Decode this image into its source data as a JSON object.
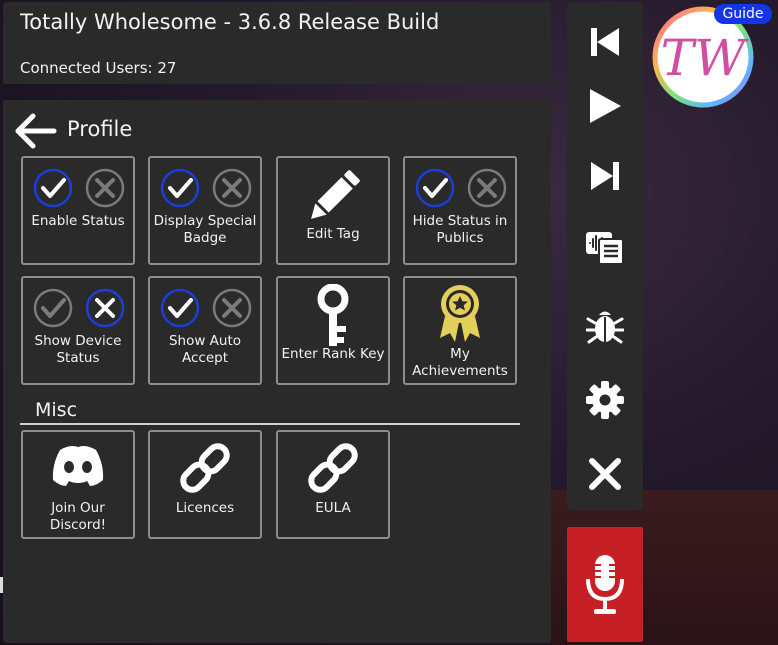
{
  "header": {
    "title": "Totally Wholesome - 3.6.8 Release Build",
    "connected_users": "Connected Users: 27"
  },
  "profile": {
    "title": "Profile",
    "tiles": [
      {
        "label": "Enable Status",
        "icon": "check-icon",
        "state": "enabled"
      },
      {
        "label": "Display Special Badge",
        "icon": "check-icon",
        "state": "enabled"
      },
      {
        "label": "Edit Tag",
        "icon": "pencil-icon"
      },
      {
        "label": "Hide Status in Publics",
        "icon": "check-icon",
        "state": "enabled"
      },
      {
        "label": "Show Device Status",
        "icon": "cross-icon",
        "state": "disabled"
      },
      {
        "label": "Show Auto Accept",
        "icon": "check-icon",
        "state": "enabled"
      },
      {
        "label": "Enter Rank Key",
        "icon": "key-icon"
      },
      {
        "label": "My Achievements",
        "icon": "award-ribbon-icon"
      }
    ]
  },
  "misc": {
    "title": "Misc",
    "tiles": [
      {
        "label": "Join Our Discord!",
        "icon": "discord-icon"
      },
      {
        "label": "Licences",
        "icon": "link-icon"
      },
      {
        "label": "EULA",
        "icon": "link-icon"
      }
    ]
  },
  "sidebar": {
    "items": [
      "skip-previous-icon",
      "play-icon",
      "skip-next-icon",
      "voice-transcript-icon",
      "bug-icon",
      "gear-icon",
      "close-icon"
    ]
  },
  "logo": {
    "text": "TW",
    "guide_label": "Guide"
  },
  "colors": {
    "panel": "#2a2a2a",
    "accent_blue": "#1535e8",
    "mic_red": "#c62026",
    "achievement_gold": "#e3cf59"
  }
}
